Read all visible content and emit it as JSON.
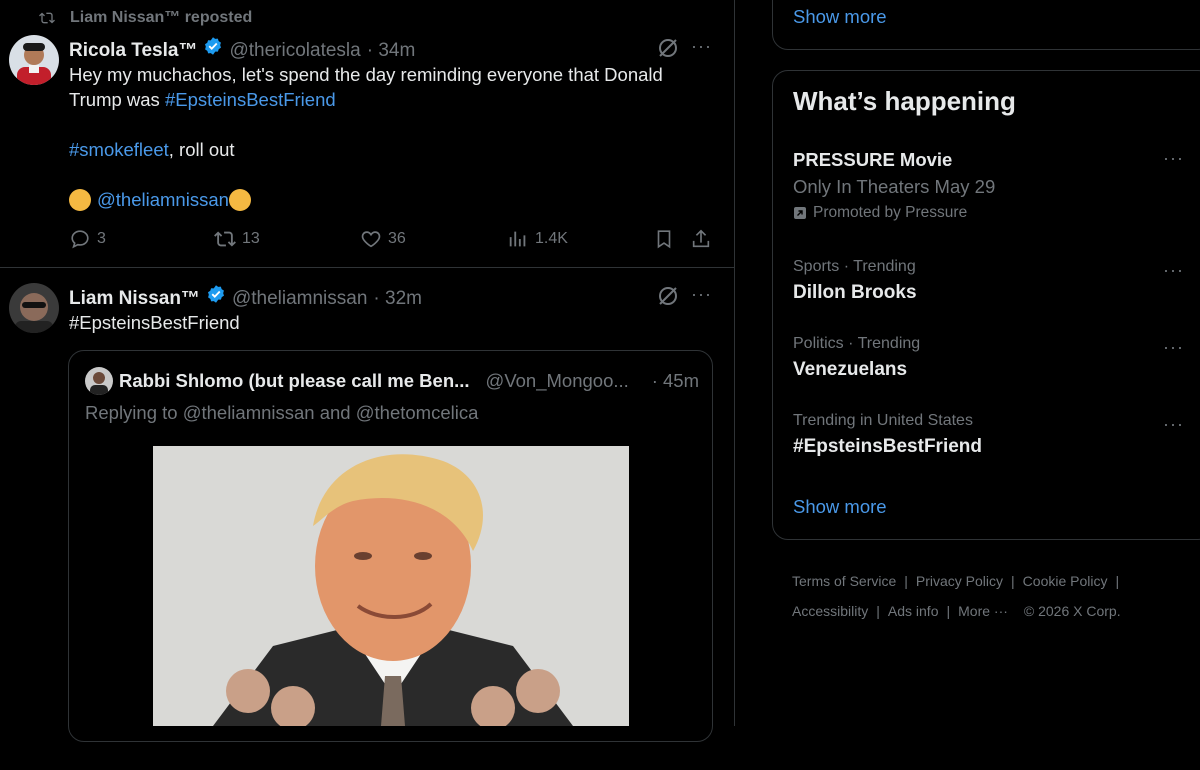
{
  "timeline": {
    "post1": {
      "repost_label": "Liam Nissan™ reposted",
      "name": "Ricola Tesla™",
      "handle": "@thericolatesla",
      "time": "· 34m",
      "line1": "Hey my muchachos, let's spend the day reminding everyone that Donald",
      "line2_prefix": "Trump was ",
      "line2_tag": "#EpsteinsBestFriend",
      "tag2": "#smokefleet",
      "tag2_suffix": ", roll out",
      "mention": "@theliamnissan",
      "replies": "3",
      "reposts": "13",
      "likes": "36",
      "views": "1.4K"
    },
    "post2": {
      "name": "Liam Nissan™",
      "handle": "@theliamnissan",
      "time": "· 32m",
      "text": "#EpsteinsBestFriend",
      "quote": {
        "name": "Rabbi Shlomo (but please call me Ben...",
        "handle": "@Von_Mongoo...",
        "time": "· 45m",
        "replying": "Replying to @theliamnissan and @thetomcelica"
      }
    }
  },
  "sidebar": {
    "show_more_top": "Show more",
    "title": "What’s happening",
    "trends": [
      {
        "title": "PRESSURE Movie",
        "sub": "Only In Theaters May 29",
        "promo": "Promoted by Pressure"
      },
      {
        "meta": "Sports · Trending",
        "title": "Dillon Brooks"
      },
      {
        "meta": "Politics · Trending",
        "title": "Venezuelans"
      },
      {
        "meta": "Trending in United States",
        "title": "#EpsteinsBestFriend"
      }
    ],
    "show_more_bottom": "Show more",
    "footer": {
      "terms": "Terms of Service",
      "privacy": "Privacy Policy",
      "cookie": "Cookie Policy",
      "accessibility": "Accessibility",
      "ads": "Ads info",
      "more": "More ···",
      "copyright": "© 2026 X Corp."
    }
  },
  "colors": {
    "accent": "#1d9bf0",
    "link": "#4a99e9",
    "muted": "#71767b",
    "border": "#2f3336"
  }
}
